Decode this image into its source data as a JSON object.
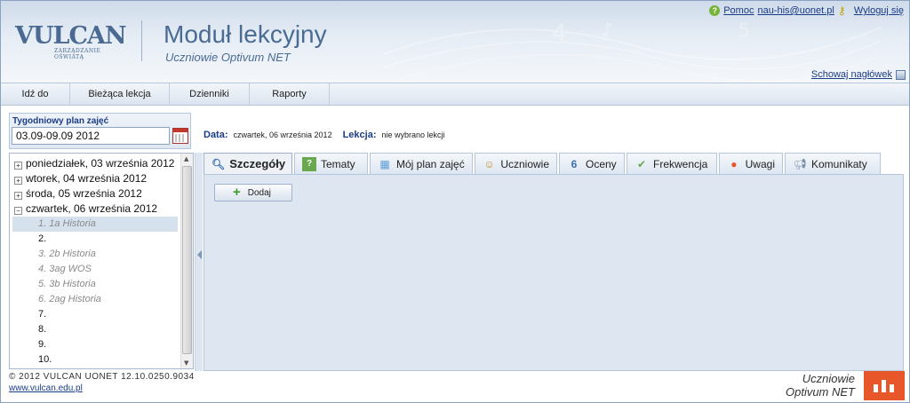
{
  "header": {
    "logo_text": "VULCAN",
    "logo_tagline": "ZARZĄDZANIE OŚWIATĄ",
    "title": "Moduł lekcyjny",
    "subtitle": "Uczniowie Optivum NET",
    "help_label": "Pomoc",
    "user_email": "nau-his@uonet.pl",
    "logout_label": "Wyloguj się",
    "hide_header_label": "Schowaj nagłówek"
  },
  "menu": {
    "items": [
      {
        "label": "Idź do"
      },
      {
        "label": "Bieżąca lekcja"
      },
      {
        "label": "Dzienniki"
      },
      {
        "label": "Raporty"
      }
    ]
  },
  "week": {
    "label": "Tygodniowy plan zajęć",
    "value": "03.09-09.09 2012"
  },
  "tree": {
    "days": [
      {
        "label": "poniedziałek, 03 września 2012",
        "toggle": "+"
      },
      {
        "label": "wtorek, 04 września 2012",
        "toggle": "+"
      },
      {
        "label": "środa, 05 września 2012",
        "toggle": "+"
      },
      {
        "label": "czwartek, 06 września 2012",
        "toggle": "−"
      }
    ],
    "lessons": [
      {
        "label": "1. 1a   Historia"
      },
      {
        "label": "2."
      },
      {
        "label": "3. 2b   Historia"
      },
      {
        "label": "4. 3ag  WOS"
      },
      {
        "label": "5. 3b   Historia"
      },
      {
        "label": "6. 2ag  Historia"
      },
      {
        "label": "7."
      },
      {
        "label": "8."
      },
      {
        "label": "9."
      },
      {
        "label": "10."
      }
    ]
  },
  "info": {
    "date_label": "Data:",
    "date_value": "czwartek, 06 września 2012",
    "lesson_label": "Lekcja:",
    "lesson_value": "nie wybrano lekcji"
  },
  "tabs": [
    {
      "label": "Szczegóły",
      "icon": "magnifier-icon"
    },
    {
      "label": "Tematy",
      "icon": "question-book-icon"
    },
    {
      "label": "Mój plan zajęć",
      "icon": "schedule-grid-icon"
    },
    {
      "label": "Uczniowie",
      "icon": "students-icon"
    },
    {
      "label": "Oceny",
      "icon": "grades-icon"
    },
    {
      "label": "Frekwencja",
      "icon": "attendance-icon"
    },
    {
      "label": "Uwagi",
      "icon": "remarks-icon"
    },
    {
      "label": "Komunikaty",
      "icon": "megaphone-icon"
    }
  ],
  "actions": {
    "add_label": "Dodaj"
  },
  "footer": {
    "copyright": "© 2012 VULCAN UONET 12.10.0250.9034",
    "link": "www.vulcan.edu.pl",
    "brand_line1": "Uczniowie",
    "brand_line2": "Optivum NET"
  },
  "colors": {
    "accent": "#1a3b86",
    "brand": "#e8572a",
    "panel": "#dde6f1"
  }
}
